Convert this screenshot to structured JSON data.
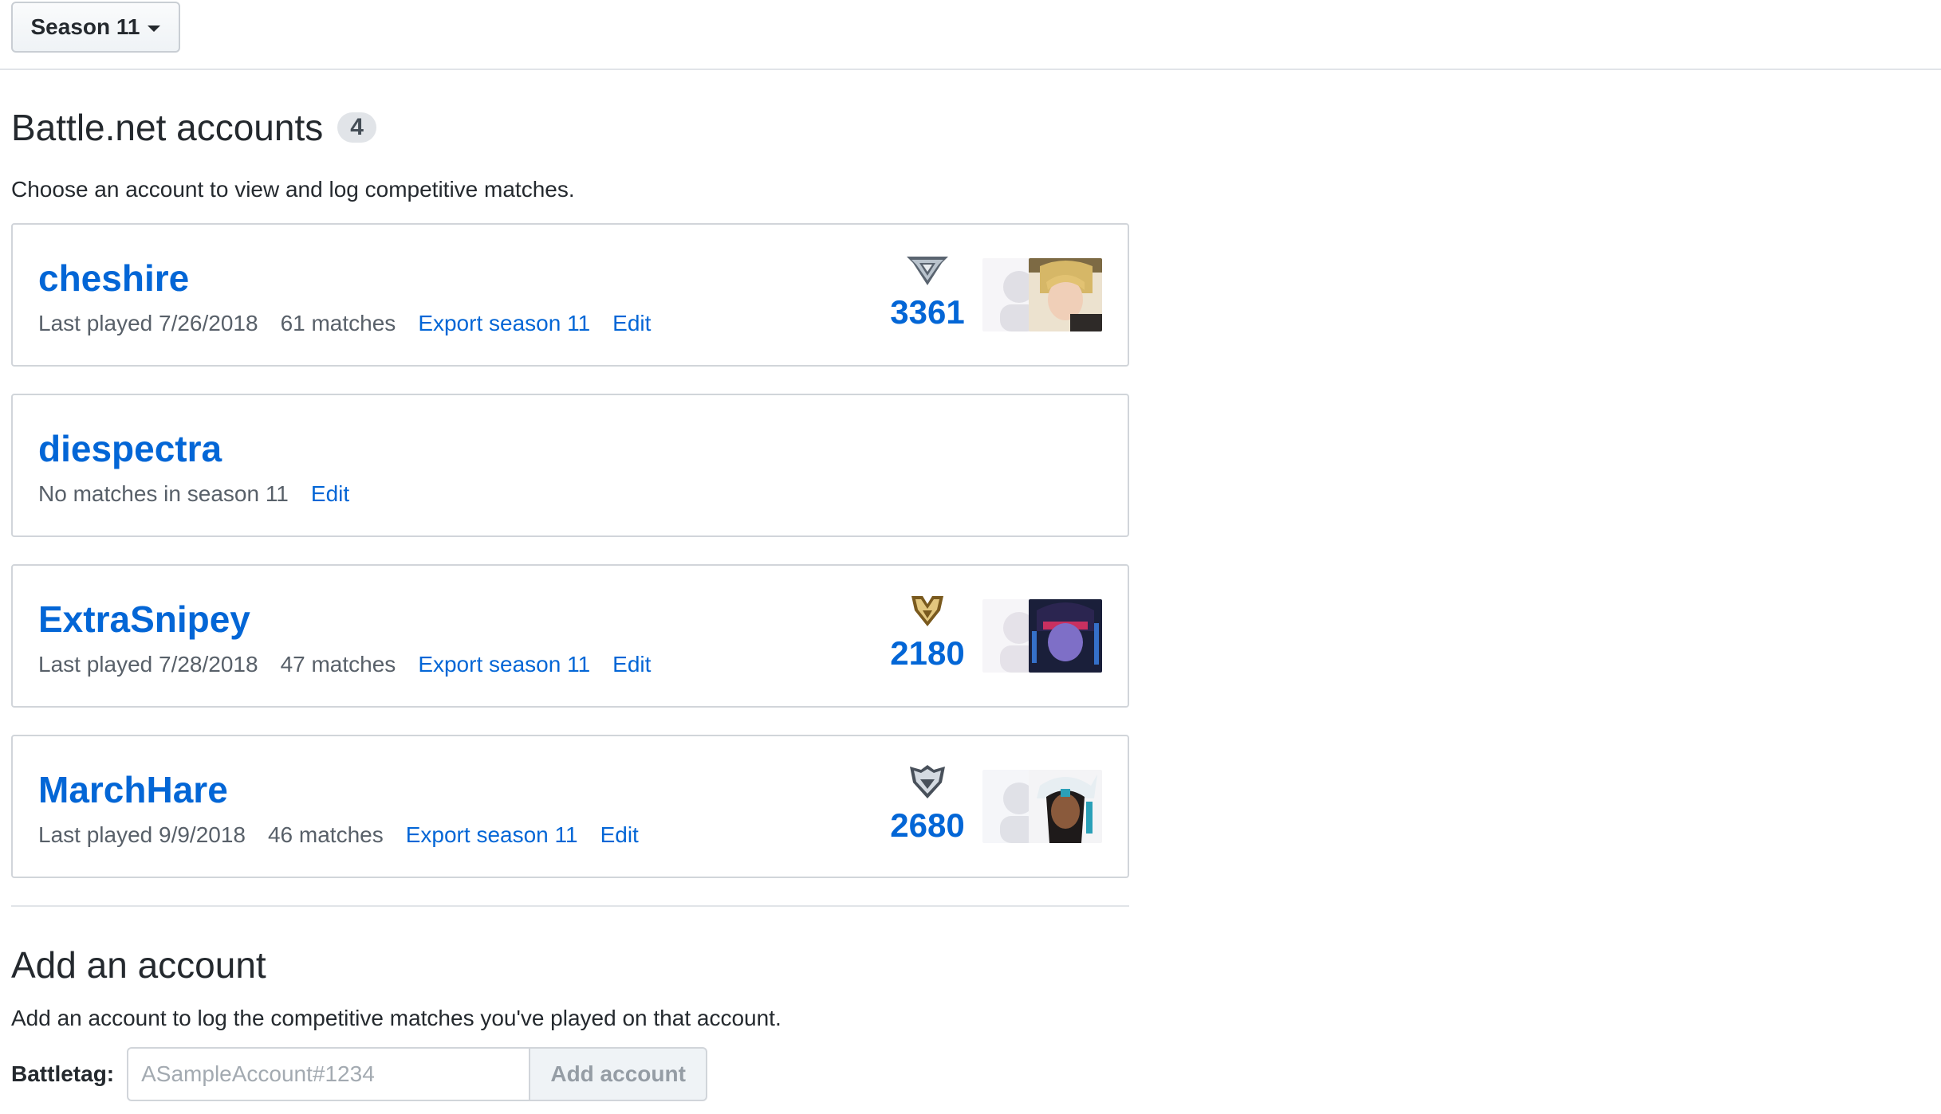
{
  "season_button": {
    "label": "Season 11"
  },
  "accounts_section": {
    "title": "Battle.net accounts",
    "count": "4",
    "description": "Choose an account to view and log competitive matches."
  },
  "accounts": [
    {
      "name": "cheshire",
      "last_played": "Last played 7/26/2018",
      "matches": "61 matches",
      "export": "Export season 11",
      "edit": "Edit",
      "sr": "3361",
      "rank_icon": "master-rank-icon",
      "hero_icons": [
        "hero-silhouette-icon",
        "mercy-hero-icon"
      ]
    },
    {
      "name": "diespectra",
      "status": "No matches in season 11",
      "edit": "Edit"
    },
    {
      "name": "ExtraSnipey",
      "last_played": "Last played 7/28/2018",
      "matches": "47 matches",
      "export": "Export season 11",
      "edit": "Edit",
      "sr": "2180",
      "rank_icon": "gold-rank-icon",
      "hero_icons": [
        "hero-silhouette-icon",
        "widowmaker-hero-icon"
      ]
    },
    {
      "name": "MarchHare",
      "last_played": "Last played 9/9/2018",
      "matches": "46 matches",
      "export": "Export season 11",
      "edit": "Edit",
      "sr": "2680",
      "rank_icon": "platinum-rank-icon",
      "hero_icons": [
        "hero-silhouette-icon",
        "symmetra-hero-icon"
      ]
    }
  ],
  "add_section": {
    "title": "Add an account",
    "description": "Add an account to log the competitive matches you've played on that account.",
    "label": "Battletag:",
    "placeholder": "ASampleAccount#1234",
    "button": "Add account"
  },
  "colors": {
    "link": "#0366d6",
    "border": "#d1d5da",
    "badge": "#e1e4e8"
  }
}
